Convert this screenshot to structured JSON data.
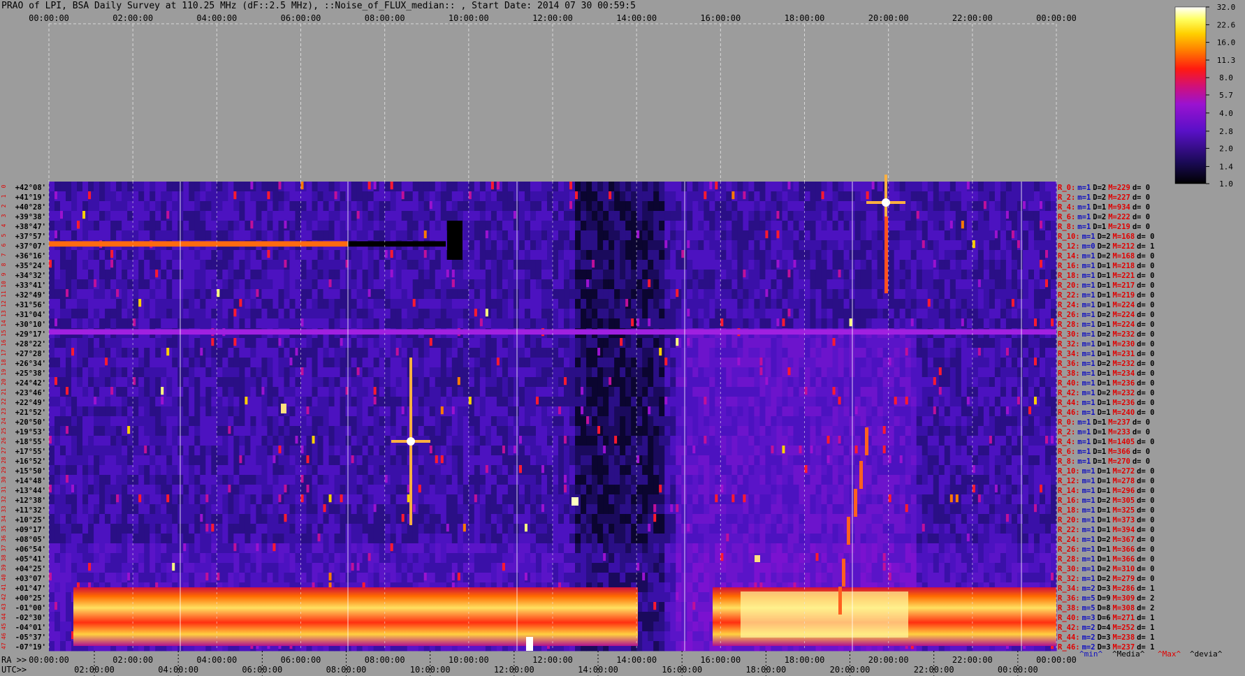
{
  "title": "PRAO of LPI, BSA Daily Survey at 110.25 MHz (dF::2.5 MHz), ::Noise_of_FLUX_median:: , Start Date: 2014 07 30 00:59:5",
  "chart_data": {
    "type": "heatmap",
    "title": "PRAO of LPI, BSA Daily Survey at 110.25 MHz (dF::2.5 MHz), ::Noise_of_FLUX_median:: , Start Date: 2014 07 30 00:59:5",
    "top_axis_ticks": [
      "00:00:00",
      "02:00:00",
      "04:00:00",
      "06:00:00",
      "08:00:00",
      "10:00:00",
      "12:00:00",
      "14:00:00",
      "16:00:00",
      "18:00:00",
      "20:00:00",
      "22:00:00",
      "00:00:00"
    ],
    "ra_axis_prefix": "RA >>",
    "ra_axis_ticks": [
      "00:00:00",
      "02:00:00",
      "04:00:00",
      "06:00:00",
      "08:00:00",
      "10:00:00",
      "12:00:00",
      "14:00:00",
      "16:00:00",
      "18:00:00",
      "20:00:00",
      "22:00:00",
      "00:00:00"
    ],
    "utc_axis_prefix": "UTC>>",
    "utc_axis_ticks": [
      "02:00:00",
      "04:00:00",
      "06:00:00",
      "08:00:00",
      "10:00:00",
      "12:00:00",
      "14:00:00",
      "16:00:00",
      "18:00:00",
      "20:00:00",
      "22:00:00",
      "00:00:00"
    ],
    "colorbar_ticks": [
      "32.0",
      "22.6",
      "16.0",
      "11.3",
      "8.0",
      "5.7",
      "4.0",
      "2.8",
      "2.0",
      "1.4",
      "1.0"
    ],
    "colorbar_scale": "log",
    "colorbar_range": [
      1.0,
      32.0
    ],
    "declinations": [
      "+42°08'",
      "+41°19'",
      "+40°28'",
      "+39°38'",
      "+38°47'",
      "+37°57'",
      "+37°07'",
      "+36°16'",
      "+35°24'",
      "+34°32'",
      "+33°41'",
      "+32°49'",
      "+31°56'",
      "+31°04'",
      "+30°10'",
      "+29°17'",
      "+28°22'",
      "+27°28'",
      "+26°34'",
      "+25°38'",
      "+24°42'",
      "+23°46'",
      "+22°49'",
      "+21°52'",
      "+20°50'",
      "+19°53'",
      "+18°55'",
      "+17°55'",
      "+16°52'",
      "+15°50'",
      "+14°48'",
      "+13°44'",
      "+12°38'",
      "+11°32'",
      "+10°25'",
      "+09°17'",
      "+08°05'",
      "+06°54'",
      "+05°41'",
      "+04°25'",
      "+03°07'",
      "+01°47'",
      "+00°25'",
      "-01°00'",
      "-02°30'",
      "-04°01'",
      "-05°37'",
      "-07°19'"
    ],
    "beam_numbers": [
      "0",
      "1",
      "2",
      "3",
      "4",
      "5",
      "6",
      "7",
      "8",
      "9",
      "10",
      "11",
      "12",
      "13",
      "14",
      "15",
      "16",
      "17",
      "18",
      "19",
      "20",
      "21",
      "22",
      "23",
      "24",
      "25",
      "26",
      "27",
      "28",
      "29",
      "30",
      "31",
      "32",
      "33",
      "34",
      "35",
      "36",
      "37",
      "38",
      "39",
      "40",
      "41",
      "42",
      "43",
      "44",
      "45",
      "46",
      "47"
    ],
    "receiver_stats": [
      {
        "r": "R_0:",
        "m": "m=1",
        "D": "D=2",
        "M": "M=229",
        "d": "d= 0"
      },
      {
        "r": "R_2:",
        "m": "m=1",
        "D": "D=2",
        "M": "M=227",
        "d": "d= 0"
      },
      {
        "r": "R_4:",
        "m": "m=1",
        "D": "D=1",
        "M": "M=934",
        "d": "d= 0"
      },
      {
        "r": "R_6:",
        "m": "m=1",
        "D": "D=2",
        "M": "M=222",
        "d": "d= 0"
      },
      {
        "r": "R_8:",
        "m": "m=1",
        "D": "D=1",
        "M": "M=219",
        "d": "d= 0"
      },
      {
        "r": "R_10:",
        "m": "m=1",
        "D": "D=2",
        "M": "M=168",
        "d": "d= 0"
      },
      {
        "r": "R_12:",
        "m": "m=0",
        "D": "D=2",
        "M": "M=212",
        "d": "d= 1"
      },
      {
        "r": "R_14:",
        "m": "m=1",
        "D": "D=2",
        "M": "M=168",
        "d": "d= 0"
      },
      {
        "r": "R_16:",
        "m": "m=1",
        "D": "D=1",
        "M": "M=218",
        "d": "d= 0"
      },
      {
        "r": "R_18:",
        "m": "m=1",
        "D": "D=1",
        "M": "M=221",
        "d": "d= 0"
      },
      {
        "r": "R_20:",
        "m": "m=1",
        "D": "D=1",
        "M": "M=217",
        "d": "d= 0"
      },
      {
        "r": "R_22:",
        "m": "m=1",
        "D": "D=1",
        "M": "M=219",
        "d": "d= 0"
      },
      {
        "r": "R_24:",
        "m": "m=1",
        "D": "D=1",
        "M": "M=224",
        "d": "d= 0"
      },
      {
        "r": "R_26:",
        "m": "m=1",
        "D": "D=2",
        "M": "M=224",
        "d": "d= 0"
      },
      {
        "r": "R_28:",
        "m": "m=1",
        "D": "D=1",
        "M": "M=224",
        "d": "d= 0"
      },
      {
        "r": "R_30:",
        "m": "m=1",
        "D": "D=2",
        "M": "M=232",
        "d": "d= 0"
      },
      {
        "r": "R_32:",
        "m": "m=1",
        "D": "D=1",
        "M": "M=230",
        "d": "d= 0"
      },
      {
        "r": "R_34:",
        "m": "m=1",
        "D": "D=1",
        "M": "M=231",
        "d": "d= 0"
      },
      {
        "r": "R_36:",
        "m": "m=1",
        "D": "D=2",
        "M": "M=232",
        "d": "d= 0"
      },
      {
        "r": "R_38:",
        "m": "m=1",
        "D": "D=1",
        "M": "M=234",
        "d": "d= 0"
      },
      {
        "r": "R_40:",
        "m": "m=1",
        "D": "D=1",
        "M": "M=236",
        "d": "d= 0"
      },
      {
        "r": "R_42:",
        "m": "m=1",
        "D": "D=2",
        "M": "M=232",
        "d": "d= 0"
      },
      {
        "r": "R_44:",
        "m": "m=1",
        "D": "D=1",
        "M": "M=236",
        "d": "d= 0"
      },
      {
        "r": "R_46:",
        "m": "m=1",
        "D": "D=1",
        "M": "M=240",
        "d": "d= 0"
      },
      {
        "r": "R_0:",
        "m": "m=1",
        "D": "D=1",
        "M": "M=237",
        "d": "d= 0"
      },
      {
        "r": "R_2:",
        "m": "m=1",
        "D": "D=1",
        "M": "M=233",
        "d": "d= 0"
      },
      {
        "r": "R_4:",
        "m": "m=1",
        "D": "D=1",
        "M": "M=1405",
        "d": "d= 0"
      },
      {
        "r": "R_6:",
        "m": "m=1",
        "D": "D=1",
        "M": "M=366",
        "d": "d= 0"
      },
      {
        "r": "R_8:",
        "m": "m=1",
        "D": "D=1",
        "M": "M=270",
        "d": "d= 0"
      },
      {
        "r": "R_10:",
        "m": "m=1",
        "D": "D=1",
        "M": "M=272",
        "d": "d= 0"
      },
      {
        "r": "R_12:",
        "m": "m=1",
        "D": "D=1",
        "M": "M=278",
        "d": "d= 0"
      },
      {
        "r": "R_14:",
        "m": "m=1",
        "D": "D=1",
        "M": "M=296",
        "d": "d= 0"
      },
      {
        "r": "R_16:",
        "m": "m=1",
        "D": "D=2",
        "M": "M=305",
        "d": "d= 0"
      },
      {
        "r": "R_18:",
        "m": "m=1",
        "D": "D=1",
        "M": "M=325",
        "d": "d= 0"
      },
      {
        "r": "R_20:",
        "m": "m=1",
        "D": "D=1",
        "M": "M=373",
        "d": "d= 0"
      },
      {
        "r": "R_22:",
        "m": "m=1",
        "D": "D=1",
        "M": "M=394",
        "d": "d= 0"
      },
      {
        "r": "R_24:",
        "m": "m=1",
        "D": "D=2",
        "M": "M=367",
        "d": "d= 0"
      },
      {
        "r": "R_26:",
        "m": "m=1",
        "D": "D=1",
        "M": "M=366",
        "d": "d= 0"
      },
      {
        "r": "R_28:",
        "m": "m=1",
        "D": "D=1",
        "M": "M=366",
        "d": "d= 0"
      },
      {
        "r": "R_30:",
        "m": "m=1",
        "D": "D=2",
        "M": "M=310",
        "d": "d= 0"
      },
      {
        "r": "R_32:",
        "m": "m=1",
        "D": "D=2",
        "M": "M=279",
        "d": "d= 0"
      },
      {
        "r": "R_34:",
        "m": "m=2",
        "D": "D=3",
        "M": "M=286",
        "d": "d= 1"
      },
      {
        "r": "R_36:",
        "m": "m=5",
        "D": "D=9",
        "M": "M=309",
        "d": "d= 2"
      },
      {
        "r": "R_38:",
        "m": "m=5",
        "D": "D=8",
        "M": "M=308",
        "d": "d= 2"
      },
      {
        "r": "R_40:",
        "m": "m=3",
        "D": "D=6",
        "M": "M=271",
        "d": "d= 1"
      },
      {
        "r": "R_42:",
        "m": "m=2",
        "D": "D=4",
        "M": "M=252",
        "d": "d= 1"
      },
      {
        "r": "R_44:",
        "m": "m=2",
        "D": "D=3",
        "M": "M=238",
        "d": "d= 1"
      },
      {
        "r": "R_46:",
        "m": "m=2",
        "D": "D=3",
        "M": "M=237",
        "d": "d= 1"
      }
    ],
    "stats_legend": [
      "^min^",
      "^Media^",
      "^Max^",
      "^devia^"
    ],
    "colors": {
      "background": "#9c9c9c",
      "label_red": "#e00000",
      "label_blue": "#1010c0",
      "label_black": "#000000"
    }
  }
}
